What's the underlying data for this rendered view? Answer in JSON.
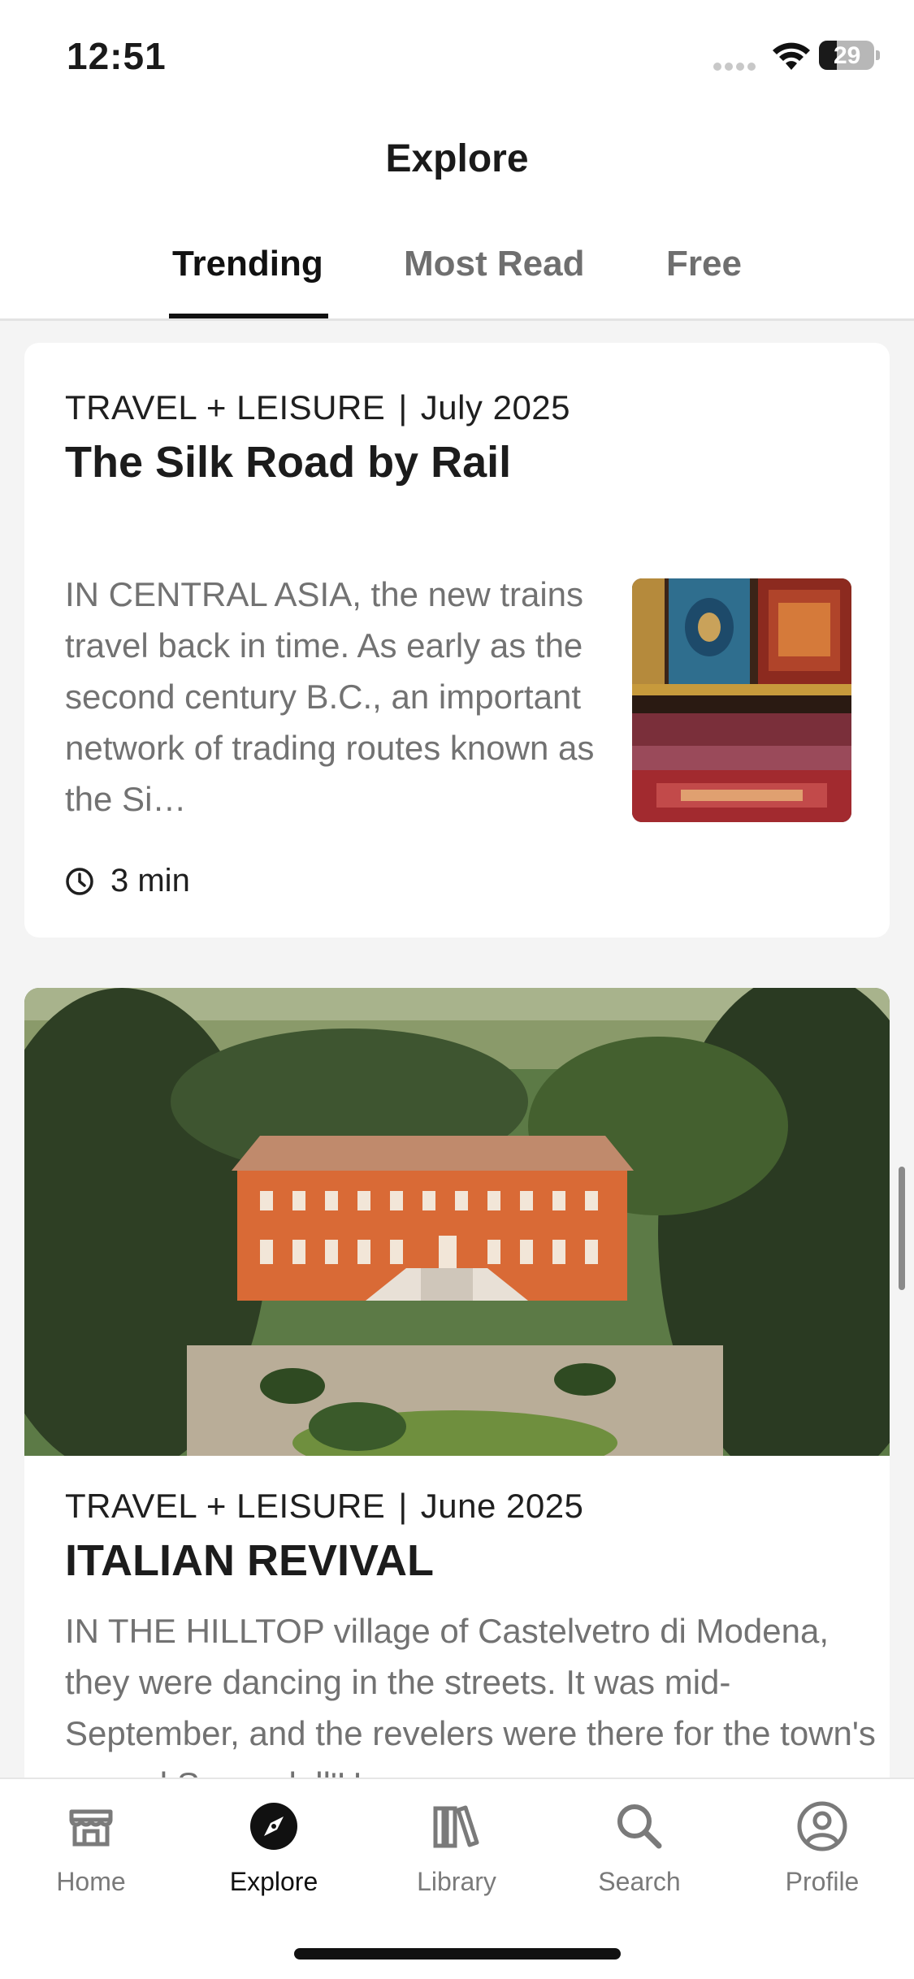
{
  "status_bar": {
    "time": "12:51",
    "battery": "29"
  },
  "header": {
    "title": "Explore",
    "tabs": [
      {
        "label": "Trending",
        "active": true
      },
      {
        "label": "Most Read",
        "active": false
      },
      {
        "label": "Free",
        "active": false
      }
    ]
  },
  "articles": [
    {
      "publication": "TRAVEL + LEISURE",
      "separator": "|",
      "date": "July 2025",
      "title": "The Silk Road by Rail",
      "excerpt": "IN CENTRAL ASIA, the new trains travel back in time. As early as the second century B.C., an important network of trading routes known as the Si…",
      "read_time": "3 min",
      "image": "carpet-market-image"
    },
    {
      "publication": "TRAVEL + LEISURE",
      "separator": "|",
      "date": "June 2025",
      "title": "ITALIAN REVIVAL",
      "excerpt": "IN THE HILLTOP village of Castelvetro di Modena, they were dancing in the streets. It was mid-September, and the revelers were there for the town's annual Sagra dell'Uva, or",
      "image": "italian-villa-image"
    }
  ],
  "tab_bar": {
    "items": [
      {
        "label": "Home",
        "icon": "home-icon",
        "active": false
      },
      {
        "label": "Explore",
        "icon": "compass-icon",
        "active": true
      },
      {
        "label": "Library",
        "icon": "library-icon",
        "active": false
      },
      {
        "label": "Search",
        "icon": "search-icon",
        "active": false
      },
      {
        "label": "Profile",
        "icon": "profile-icon",
        "active": false
      }
    ]
  },
  "colors": {
    "accent": "#111111",
    "muted": "#727272",
    "divider": "#e3e3e3"
  }
}
